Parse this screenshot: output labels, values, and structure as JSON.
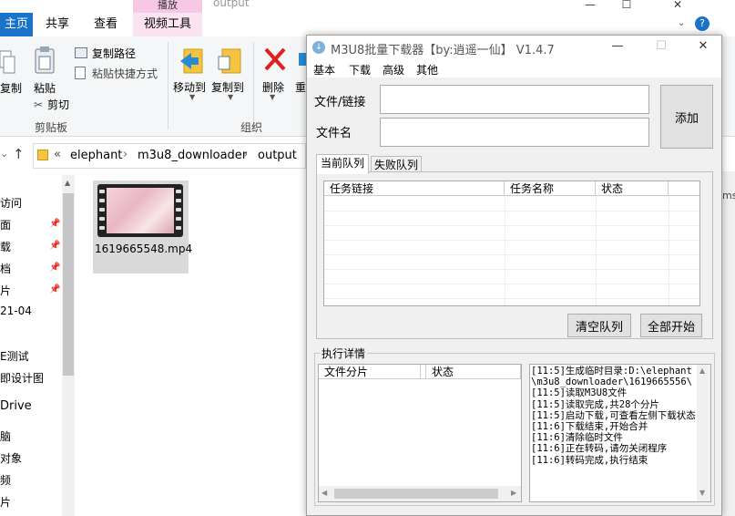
{
  "explorer": {
    "title": "output",
    "window_controls": [
      "—",
      "☐",
      "✕"
    ],
    "context_tab": "播放",
    "tabs": [
      "主页",
      "共享",
      "查看",
      "视频工具"
    ],
    "ribbon": {
      "copy_partial": "复制",
      "paste": "粘贴",
      "copy_path": "复制路径",
      "paste_shortcut": "粘贴快捷方式",
      "cut": "剪切",
      "move_to": "移动到",
      "copy_to": "复制到",
      "delete": "删除",
      "rename_partial": "重",
      "group_clipboard": "剪贴板",
      "group_organize": "组织"
    },
    "address": {
      "chevron": "«",
      "crumbs": [
        "elephant",
        "m3u8_downloader",
        "output"
      ],
      "sep": "›"
    },
    "sidebar": [
      "访问",
      "面",
      "载",
      "档",
      "片",
      "21-04",
      "E测试",
      "即设计图",
      "Drive",
      "脑",
      "对象",
      "频",
      "片"
    ],
    "file": {
      "name": "1619665548.mp4"
    },
    "right_edge_text": "ms"
  },
  "dialog": {
    "title": "M3U8批量下载器【by:逍遥一仙】 V1.4.7",
    "controls": [
      "—",
      "☐",
      "✕"
    ],
    "menu": [
      "基本",
      "下载",
      "高级",
      "其他"
    ],
    "file_link_label": "文件/链接",
    "file_name_label": "文件名",
    "file_link_value": "",
    "file_name_value": "",
    "add_button": "添加",
    "queue_tabs": [
      "当前队列",
      "失败队列"
    ],
    "queue_columns": [
      "任务链接",
      "任务名称",
      "状态"
    ],
    "clear_queue": "清空队列",
    "start_all": "全部开始",
    "exec_label": "执行详情",
    "chunk_columns": [
      "文件分片",
      "状态"
    ],
    "log": "[11:5]生成临时目录:D:\\elephant\\m3u8_downloader\\1619665556\\\n[11:5]读取M3U8文件\n[11:5]读取完成,共28个分片\n[11:5]启动下载,可查看左侧下载状态\n[11:6]下载结束,开始合并\n[11:6]清除临时文件\n[11:6]正在转码,请勿关闭程序\n[11:6]转码完成,执行结束"
  },
  "colors": {
    "home_tab": "#1a73c8",
    "video_tab": "#f6c8e6",
    "delete_icon": "#e02020",
    "folder_icon": "#f5c542",
    "arrow_icon": "#2a8ad4"
  }
}
